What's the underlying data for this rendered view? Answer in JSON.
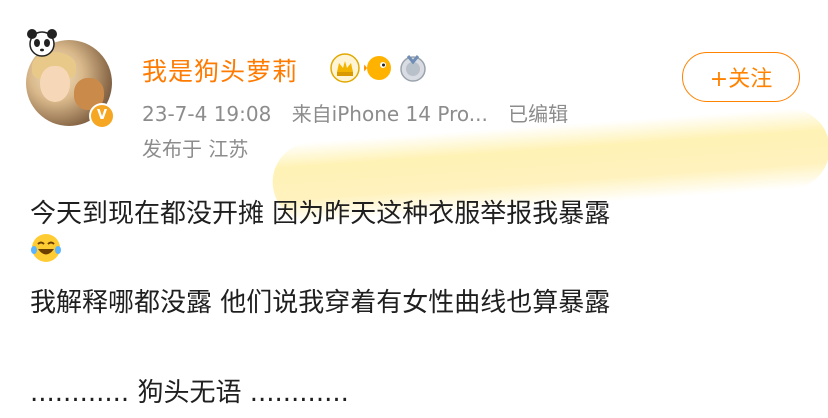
{
  "post": {
    "username": "我是狗头萝莉",
    "timestamp": "23-7-4 19:08",
    "source": "来自iPhone 14 Pro...",
    "edited": "已编辑",
    "location": "发布于 江苏",
    "follow_label": "+关注",
    "lines": [
      "今天到现在都没开摊 因为昨天这种衣服举报我暴露",
      "我解释哪都没露 他们说我穿着有女性曲线也算暴露",
      "............ 狗头无语 ............"
    ],
    "emoji": "laughing-tears-emoji",
    "badges": [
      "vip-crown-badge",
      "pufferfish-badge",
      "medal-badge"
    ]
  },
  "colors": {
    "accent": "#ff8200",
    "username": "#ff7a00",
    "meta": "#8c8c8c",
    "highlight": "#ffe678"
  }
}
